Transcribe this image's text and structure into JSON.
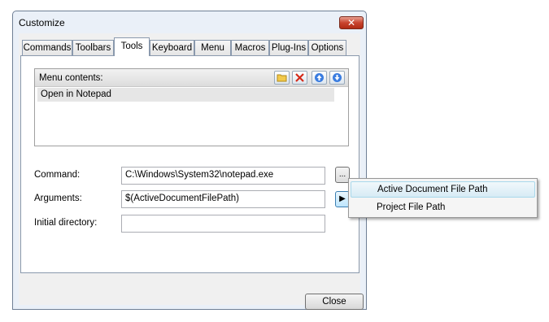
{
  "window": {
    "title": "Customize",
    "close_glyph": "✕"
  },
  "tabs": [
    {
      "label": "Commands"
    },
    {
      "label": "Toolbars"
    },
    {
      "label": "Tools"
    },
    {
      "label": "Keyboard"
    },
    {
      "label": "Menu"
    },
    {
      "label": "Macros"
    },
    {
      "label": "Plug-Ins"
    },
    {
      "label": "Options"
    }
  ],
  "menu_contents": {
    "label": "Menu contents:",
    "items": [
      "Open in Notepad"
    ],
    "toolbar_icons": [
      "new-folder-icon",
      "delete-icon",
      "move-up-icon",
      "move-down-icon"
    ]
  },
  "form": {
    "command_label": "Command:",
    "command_value": "C:\\Windows\\System32\\notepad.exe",
    "browse_label": "...",
    "arguments_label": "Arguments:",
    "arguments_value": "$(ActiveDocumentFilePath)",
    "arrow_glyph": "▶",
    "initial_dir_label": "Initial directory:",
    "initial_dir_value": ""
  },
  "close_button": "Close",
  "popup_menu": {
    "items": [
      "Active Document File Path",
      "Project File Path"
    ]
  },
  "colors": {
    "close_red": "#c9452f",
    "window_frame": "#eaf0f8",
    "highlight": "#d7ebf5"
  }
}
